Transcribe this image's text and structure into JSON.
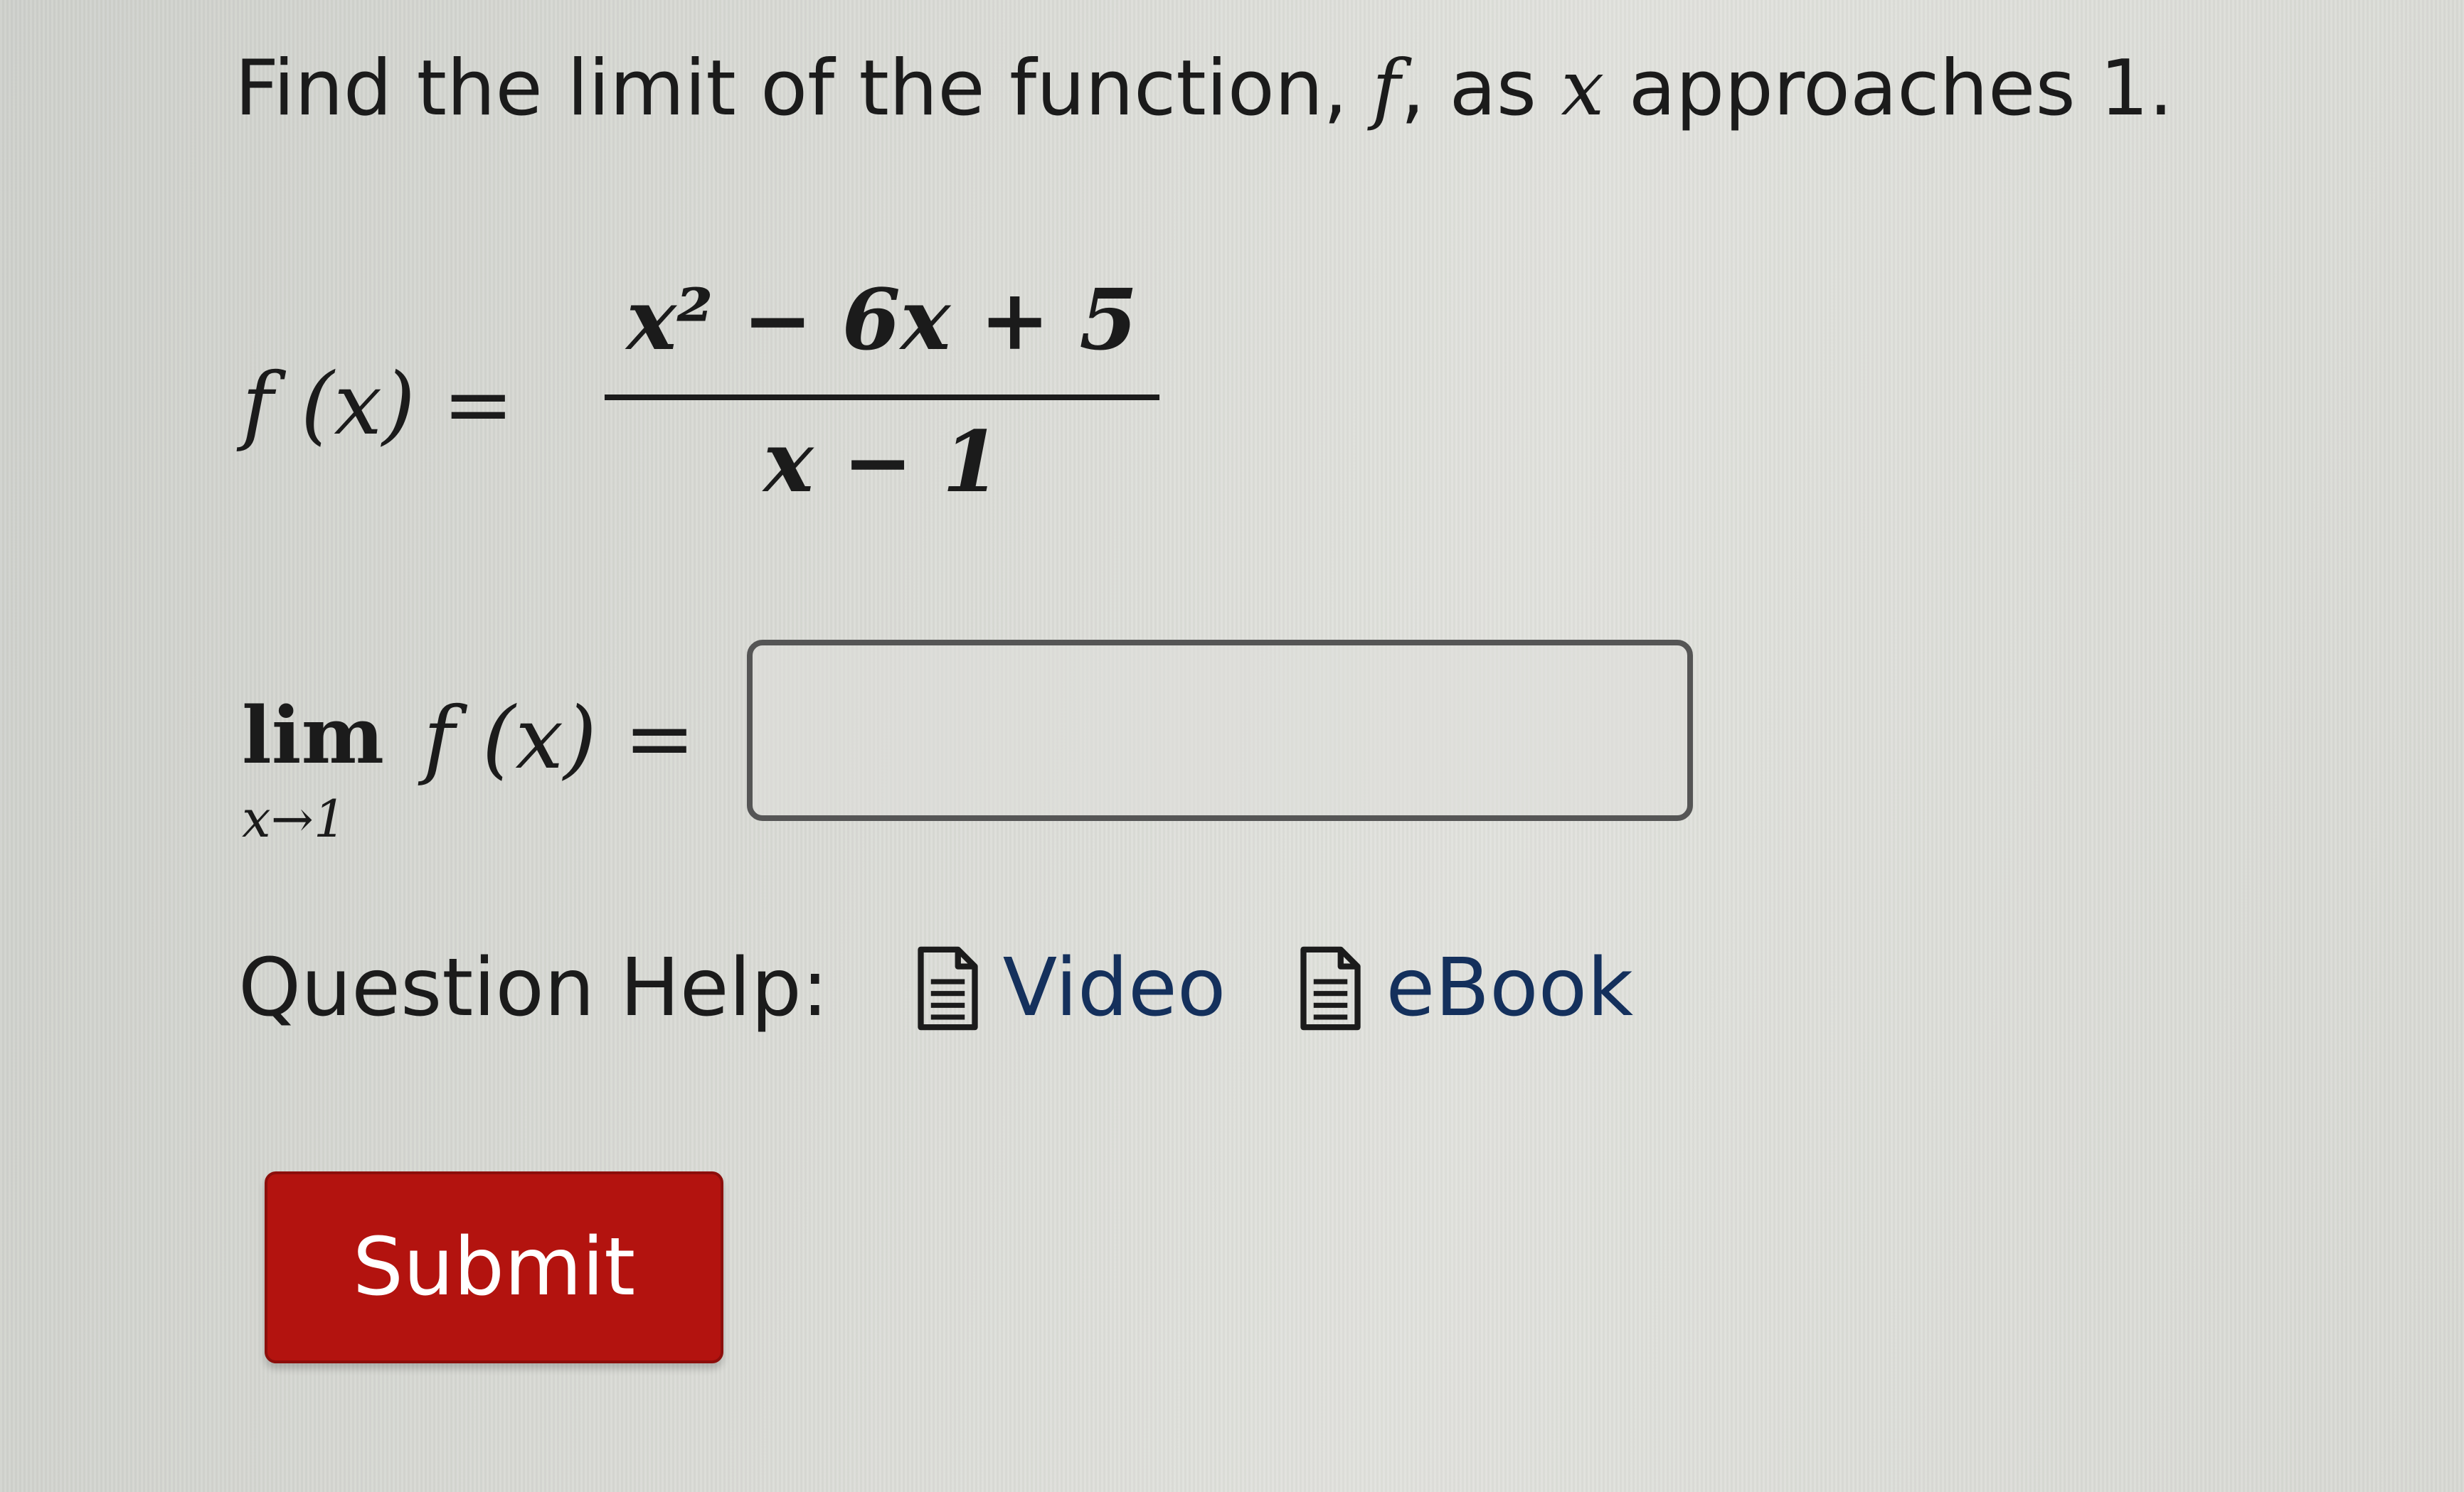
{
  "prompt": {
    "text_start": "Find the limit of the function, ",
    "func_var": "f",
    "text_mid": ", as ",
    "x_var": "x",
    "text_end": " approaches 1."
  },
  "function_def": {
    "lhs_f": "f",
    "lhs_arg": "(x)",
    "equals": "=",
    "numerator": "x² − 6x + 5",
    "denominator": "x − 1"
  },
  "limit": {
    "word": "lim",
    "subscript": "x→1",
    "expr_f": "f",
    "expr_arg": "(x)",
    "equals": "=",
    "answer_value": ""
  },
  "question_help": {
    "label": "Question Help:",
    "links": [
      {
        "label": "Video",
        "icon": "document-icon"
      },
      {
        "label": "eBook",
        "icon": "document-icon"
      }
    ]
  },
  "submit": {
    "label": "Submit"
  },
  "colors": {
    "submit_bg": "#b3130f",
    "link": "#14305c",
    "text": "#1b1b1b"
  }
}
